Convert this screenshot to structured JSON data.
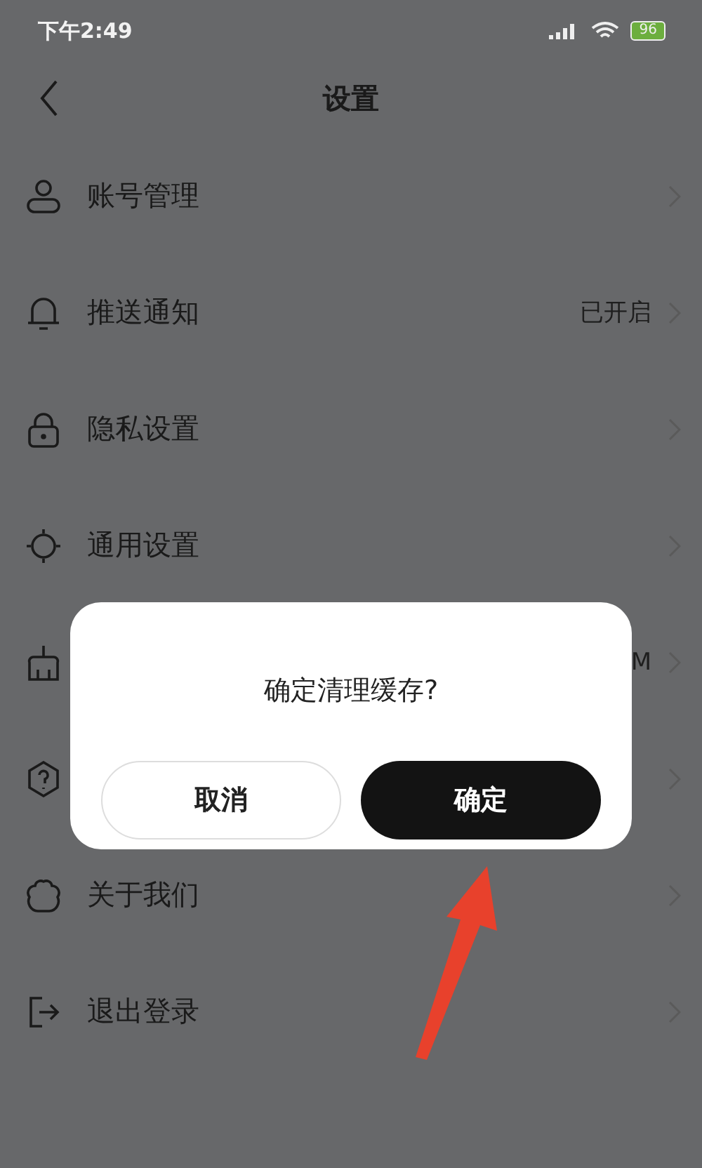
{
  "status_bar": {
    "time": "下午2:49",
    "battery": "96"
  },
  "header": {
    "title": "设置"
  },
  "settings": [
    {
      "kind": "link",
      "label": "账号管理"
    },
    {
      "kind": "link",
      "label": "推送通知",
      "value": "已开启"
    },
    {
      "kind": "link",
      "label": "隐私设置"
    },
    {
      "kind": "link",
      "label": "通用设置"
    },
    {
      "kind": "link",
      "value": "M"
    },
    {
      "kind": "link"
    },
    {
      "kind": "link",
      "label": "关于我们"
    },
    {
      "kind": "link",
      "label": "退出登录"
    }
  ],
  "dialog": {
    "message": "确定清理缓存?",
    "buttons": [
      {
        "label": "取消",
        "kind": "secondary"
      },
      {
        "label": "确定",
        "kind": "primary"
      }
    ]
  }
}
